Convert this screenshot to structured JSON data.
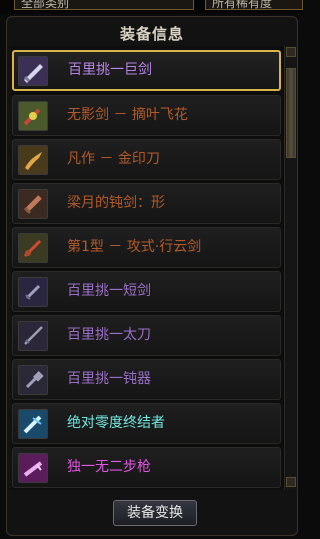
{
  "filters": {
    "left_value": "全部类别",
    "right_value": "所有稀有度"
  },
  "panel": {
    "title": "装备信息"
  },
  "items": [
    {
      "name": "百里挑一巨剑",
      "color": "#b784e8",
      "icon": "greatsword-icon",
      "icon_bg": "#3b2f55",
      "icon_fg": "#d7d7ea",
      "selected": true
    },
    {
      "name": "无影剑 － 摘叶飞花",
      "color": "#b35a2a",
      "icon": "sword-gem-icon",
      "icon_bg": "#4a5a2a",
      "icon_fg": "#c8463a"
    },
    {
      "name": "凡作 － 金印刀",
      "color": "#b35a2a",
      "icon": "blade-icon",
      "icon_bg": "#4a3a1c",
      "icon_fg": "#e0a84a"
    },
    {
      "name": "梁月的钝剑：形",
      "color": "#b35a2a",
      "icon": "blunt-sword-icon",
      "icon_bg": "#3b2a22",
      "icon_fg": "#c07a5a"
    },
    {
      "name": "第1型 － 攻式·行云剑",
      "color": "#b35a2a",
      "icon": "sword-icon",
      "icon_bg": "#3b3a22",
      "icon_fg": "#d04a34"
    },
    {
      "name": "百里挑一短剑",
      "color": "#9a6fc8",
      "icon": "shortsword-icon",
      "icon_bg": "#2b2640",
      "icon_fg": "#a0a0c0"
    },
    {
      "name": "百里挑一太刀",
      "color": "#9a6fc8",
      "icon": "katana-icon",
      "icon_bg": "#2b2638",
      "icon_fg": "#9aa0b0"
    },
    {
      "name": "百里挑一钝器",
      "color": "#9a6fc8",
      "icon": "club-icon",
      "icon_bg": "#2b2838",
      "icon_fg": "#a0a0b8"
    },
    {
      "name": "绝对零度终结者",
      "color": "#70e8e0",
      "icon": "ice-sword-icon",
      "icon_bg": "#1a4a6a",
      "icon_fg": "#d8f4ff"
    },
    {
      "name": "独一无二步枪",
      "color": "#e254e2",
      "icon": "rifle-icon",
      "icon_bg": "#5a1c5a",
      "icon_fg": "#e8b0f0"
    }
  ],
  "button": {
    "label": "装备变换"
  },
  "colors": {
    "selected_border": "#d8b54a",
    "title": "#d9d2c2"
  }
}
